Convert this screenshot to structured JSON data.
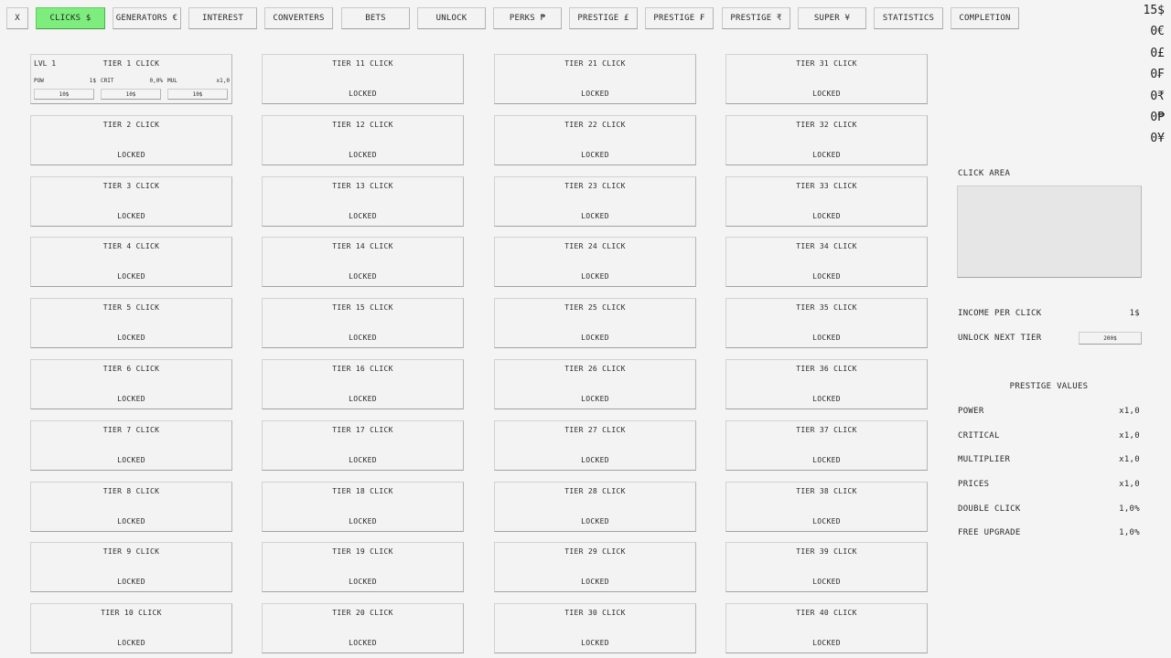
{
  "nav": {
    "items": [
      {
        "label": "X",
        "active": false
      },
      {
        "label": "CLICKS $",
        "active": true
      },
      {
        "label": "GENERATORS €",
        "active": false
      },
      {
        "label": "INTEREST",
        "active": false
      },
      {
        "label": "CONVERTERS",
        "active": false
      },
      {
        "label": "BETS",
        "active": false
      },
      {
        "label": "UNLOCK",
        "active": false
      },
      {
        "label": "PERKS ₱",
        "active": false
      },
      {
        "label": "PRESTIGE £",
        "active": false
      },
      {
        "label": "PRESTIGE ₣",
        "active": false
      },
      {
        "label": "PRESTIGE ₹",
        "active": false
      },
      {
        "label": "SUPER ¥",
        "active": false
      },
      {
        "label": "STATISTICS",
        "active": false
      },
      {
        "label": "COMPLETION",
        "active": false
      }
    ]
  },
  "balances": [
    "15$",
    "0€",
    "0£",
    "0₣",
    "0₹",
    "0₱",
    "0¥"
  ],
  "tier1": {
    "level": "LVL 1",
    "name": "TIER 1 CLICK",
    "stats": [
      {
        "key": "POW",
        "value": "1$",
        "price": "10$"
      },
      {
        "key": "CRIT",
        "value": "0,0%",
        "price": "10$"
      },
      {
        "key": "MUL",
        "value": "x1,0",
        "price": "10$"
      }
    ]
  },
  "tiers": {
    "locked_label": "LOCKED",
    "names": [
      "TIER 1 CLICK",
      "TIER 2 CLICK",
      "TIER 3 CLICK",
      "TIER 4 CLICK",
      "TIER 5 CLICK",
      "TIER 6 CLICK",
      "TIER 7 CLICK",
      "TIER 8 CLICK",
      "TIER 9 CLICK",
      "TIER 10 CLICK",
      "TIER 11 CLICK",
      "TIER 12 CLICK",
      "TIER 13 CLICK",
      "TIER 14 CLICK",
      "TIER 15 CLICK",
      "TIER 16 CLICK",
      "TIER 17 CLICK",
      "TIER 18 CLICK",
      "TIER 19 CLICK",
      "TIER 20 CLICK",
      "TIER 21 CLICK",
      "TIER 22 CLICK",
      "TIER 23 CLICK",
      "TIER 24 CLICK",
      "TIER 25 CLICK",
      "TIER 26 CLICK",
      "TIER 27 CLICK",
      "TIER 28 CLICK",
      "TIER 29 CLICK",
      "TIER 30 CLICK",
      "TIER 31 CLICK",
      "TIER 32 CLICK",
      "TIER 33 CLICK",
      "TIER 34 CLICK",
      "TIER 35 CLICK",
      "TIER 36 CLICK",
      "TIER 37 CLICK",
      "TIER 38 CLICK",
      "TIER 39 CLICK",
      "TIER 40 CLICK"
    ]
  },
  "side": {
    "click_area_label": "CLICK AREA",
    "income_label": "INCOME PER CLICK",
    "income_value": "1$",
    "unlock_label": "UNLOCK NEXT TIER",
    "unlock_price": "200$",
    "prestige_title": "PRESTIGE VALUES",
    "prestige_rows": [
      {
        "key": "POWER",
        "value": "x1,0"
      },
      {
        "key": "CRITICAL",
        "value": "x1,0"
      },
      {
        "key": "MULTIPLIER",
        "value": "x1,0"
      },
      {
        "key": "PRICES",
        "value": "x1,0"
      },
      {
        "key": "DOUBLE CLICK",
        "value": "1,0%"
      },
      {
        "key": "FREE UPGRADE",
        "value": "1,0%"
      }
    ]
  },
  "colors": {
    "active_tab": "#7dee7d",
    "background": "#f4f4f4",
    "click_area": "#e6e6e6"
  }
}
